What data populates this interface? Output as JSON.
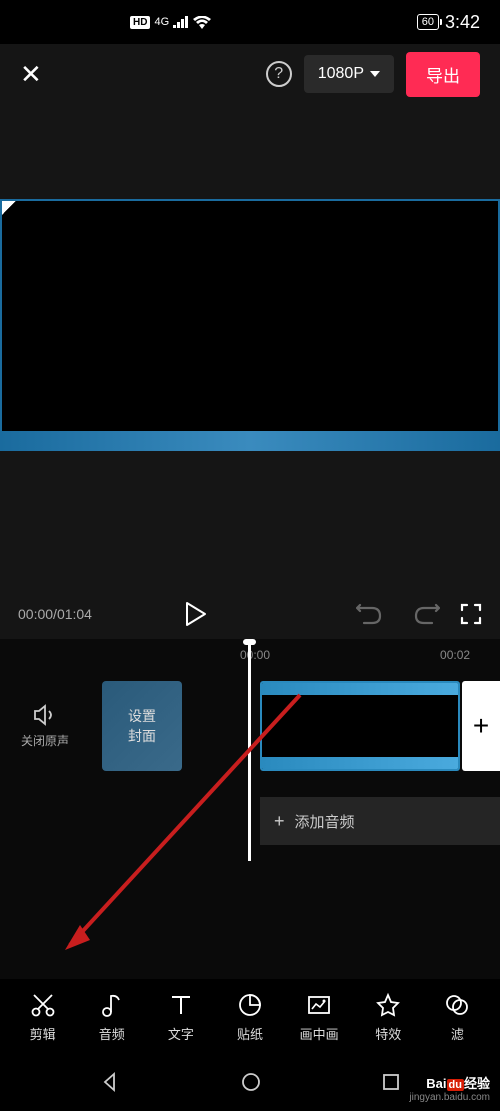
{
  "status": {
    "hd": "HD",
    "network": "4G",
    "battery": "60",
    "time": "3:42"
  },
  "toolbar": {
    "resolution": "1080P",
    "export_label": "导出"
  },
  "playback": {
    "current": "00:00",
    "total": "01:04"
  },
  "timeline": {
    "marks": [
      "00:00",
      "00:02"
    ],
    "mute_label": "关闭原声",
    "cover_label_1": "设置",
    "cover_label_2": "封面",
    "add_audio": "添加音频",
    "plus": "+"
  },
  "tools": [
    {
      "name": "edit",
      "label": "剪辑"
    },
    {
      "name": "audio",
      "label": "音频"
    },
    {
      "name": "text",
      "label": "文字"
    },
    {
      "name": "sticker",
      "label": "贴纸"
    },
    {
      "name": "pip",
      "label": "画中画"
    },
    {
      "name": "effect",
      "label": "特效"
    },
    {
      "name": "filter",
      "label": "滤"
    }
  ],
  "watermark": {
    "main_pre": "Bai",
    "main_du": "du",
    "main_post": "经验",
    "sub": "jingyan.baidu.com"
  }
}
